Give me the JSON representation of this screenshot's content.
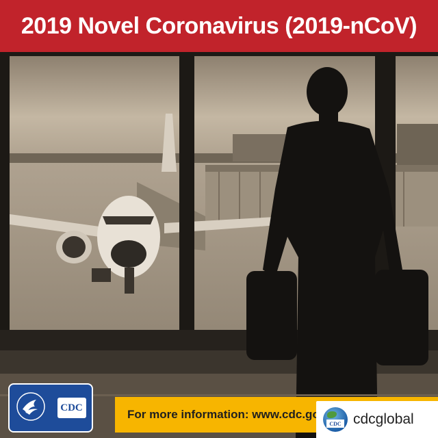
{
  "banner": {
    "title": "2019 Novel Coronavirus (2019-nCoV)"
  },
  "footer": {
    "info_text": "For more information: www.cdc.gov",
    "cdc_logo": "CDC",
    "handle": "cdcglobal"
  },
  "colors": {
    "banner": "#c1232b",
    "info_bar": "#f7b500",
    "hhs_blue": "#1e4c9a"
  },
  "icons": [
    "hhs-eagle-icon",
    "cdc-logo-icon",
    "cdc-globe-icon"
  ]
}
